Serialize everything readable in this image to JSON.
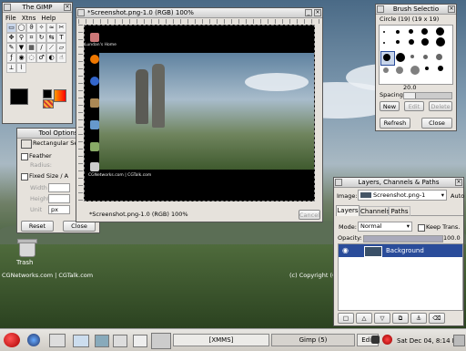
{
  "desktop": {
    "trash_label": "Trash",
    "footer_text": "CGNetworks.com | CGTalk.com",
    "copyright_text": "(c) Copyright (C) Ed"
  },
  "gimp_toolbox": {
    "title": "The GIMP",
    "menus": [
      "File",
      "Xtns",
      "Help"
    ]
  },
  "tool_options": {
    "title": "Tool Options",
    "tool_name": "Rectangular Se",
    "feather_label": "Feather",
    "radius_label": "Radius:",
    "fixed_size_label": "Fixed Size / A",
    "width_label": "Width",
    "height_label": "Height",
    "unit_label": "Unit",
    "unit_value": "px",
    "reset_label": "Reset",
    "close_label": "Close"
  },
  "image_window": {
    "title": "*Screenshot.png-1.0 (RGB) 100%",
    "status_text": "*Screenshot.png-1.0 (RGB) 100%",
    "cancel_label": "Cancel",
    "thumb_footer": "CGNetworks.com | CGTalk.com",
    "thumb_icons": [
      "Lundan's Home",
      "Firefox",
      "Mozilla",
      "GIMP",
      "Nautilus",
      "Home",
      "Trash"
    ]
  },
  "brush_window": {
    "title": "Brush Selectio",
    "brush_name": "Circle (19) (19 x 19)",
    "spacing_label": "Spacing:",
    "spacing_value": "20.0",
    "new_label": "New",
    "edit_label": "Edit",
    "delete_label": "Delete",
    "refresh_label": "Refresh",
    "close_label": "Close"
  },
  "layers_window": {
    "title": "Layers, Channels & Paths",
    "image_label": "Image:",
    "image_value": "Screenshot.png-1",
    "auto_label": "Auto",
    "tabs": [
      "Layers",
      "Channels",
      "Paths"
    ],
    "mode_label": "Mode:",
    "mode_value": "Normal",
    "keep_trans_label": "Keep Trans.",
    "opacity_label": "Opacity:",
    "opacity_value": "100.0",
    "layer_name": "Background"
  },
  "taskbar": {
    "tasks": [
      "[XMMS]",
      "Gimp (5)",
      "Edit"
    ],
    "clock": "Sat Dec 04,  8:14 PM"
  },
  "colors": {
    "selection_blue": "#2a4c9a",
    "titlebar_active": "#cfcfcf"
  }
}
